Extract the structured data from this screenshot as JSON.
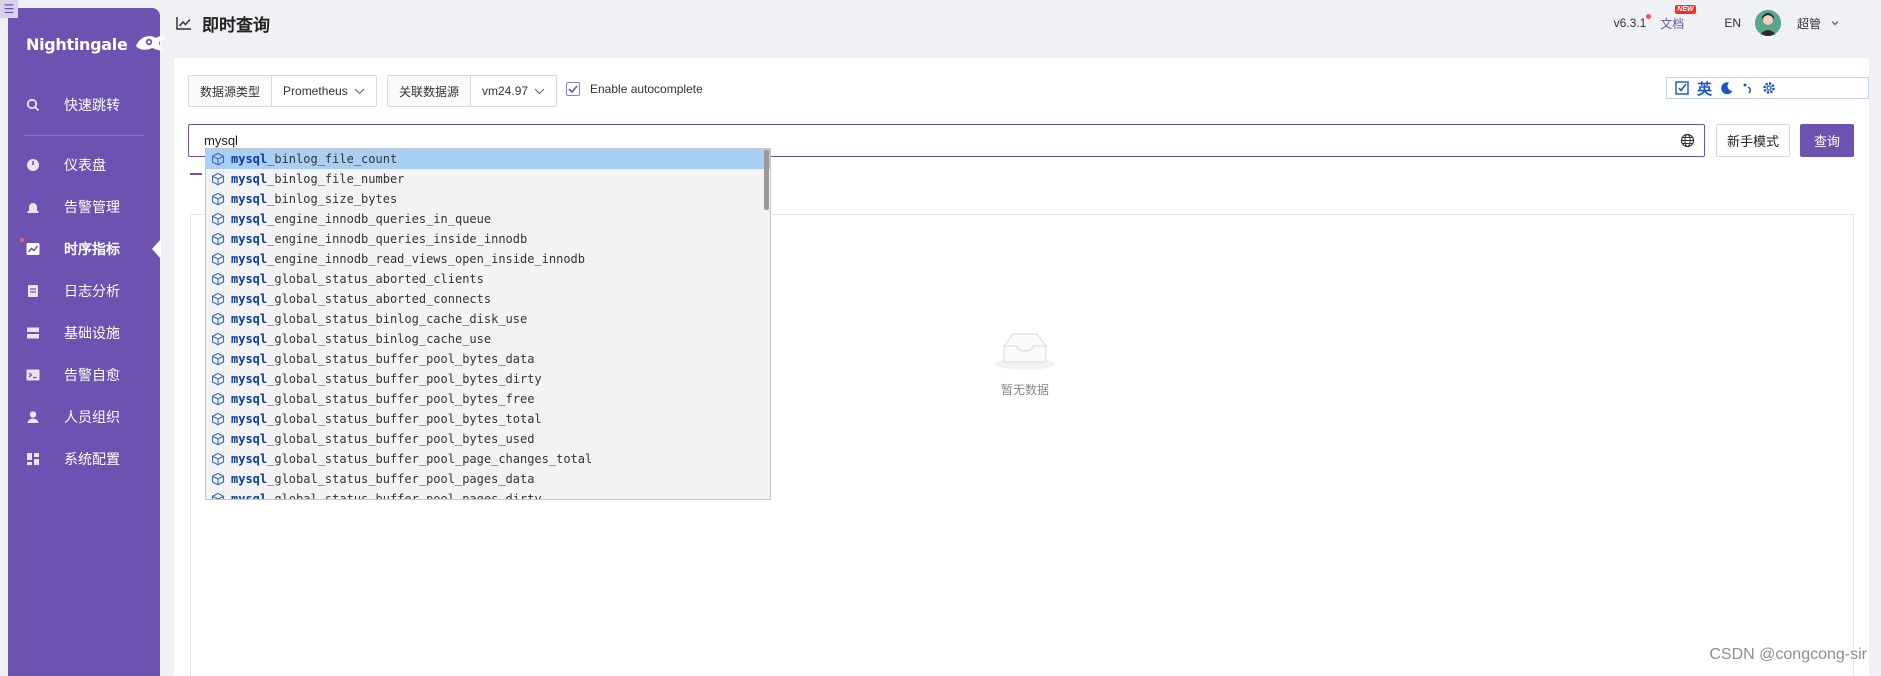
{
  "sidebar": {
    "brand": "Nightingale",
    "items": [
      {
        "label": "快速跳转",
        "icon": "search-icon"
      },
      {
        "label": "仪表盘",
        "icon": "dashboard-icon"
      },
      {
        "label": "告警管理",
        "icon": "alarm-icon"
      },
      {
        "label": "时序指标",
        "icon": "chart-icon"
      },
      {
        "label": "日志分析",
        "icon": "log-icon"
      },
      {
        "label": "基础设施",
        "icon": "server-icon"
      },
      {
        "label": "告警自愈",
        "icon": "terminal-icon"
      },
      {
        "label": "人员组织",
        "icon": "user-icon"
      },
      {
        "label": "系统配置",
        "icon": "settings-grid-icon"
      }
    ],
    "active_index": 3
  },
  "header": {
    "title": "即时查询",
    "version": "v6.3.1",
    "docs": "文档",
    "new_badge": "NEW",
    "language": "EN",
    "username": "超管"
  },
  "toolbar": {
    "datasource_type_label": "数据源类型",
    "datasource_type_value": "Prometheus",
    "datasource_label": "关联数据源",
    "datasource_value": "vm24.97",
    "autocomplete_label": "Enable autocomplete",
    "autocomplete_checked": true
  },
  "ime": {
    "lang": "英"
  },
  "query": {
    "value": "mysql",
    "novice_button": "新手模式",
    "query_button": "查询"
  },
  "suggestions": {
    "prefix": "mysql",
    "items": [
      "_binlog_file_count",
      "_binlog_file_number",
      "_binlog_size_bytes",
      "_engine_innodb_queries_in_queue",
      "_engine_innodb_queries_inside_innodb",
      "_engine_innodb_read_views_open_inside_innodb",
      "_global_status_aborted_clients",
      "_global_status_aborted_connects",
      "_global_status_binlog_cache_disk_use",
      "_global_status_binlog_cache_use",
      "_global_status_buffer_pool_bytes_data",
      "_global_status_buffer_pool_bytes_dirty",
      "_global_status_buffer_pool_bytes_free",
      "_global_status_buffer_pool_bytes_total",
      "_global_status_buffer_pool_bytes_used",
      "_global_status_buffer_pool_page_changes_total",
      "_global_status_buffer_pool_pages_data",
      "_global_status_buffer_pool_pages_dirty"
    ],
    "selected_index": 0
  },
  "results": {
    "empty_text": "暂无数据"
  },
  "watermark": "CSDN @congcong-sir",
  "colors": {
    "accent": "#6c53b1",
    "selected_row": "#a9cff4",
    "match": "#0b3e9e"
  }
}
